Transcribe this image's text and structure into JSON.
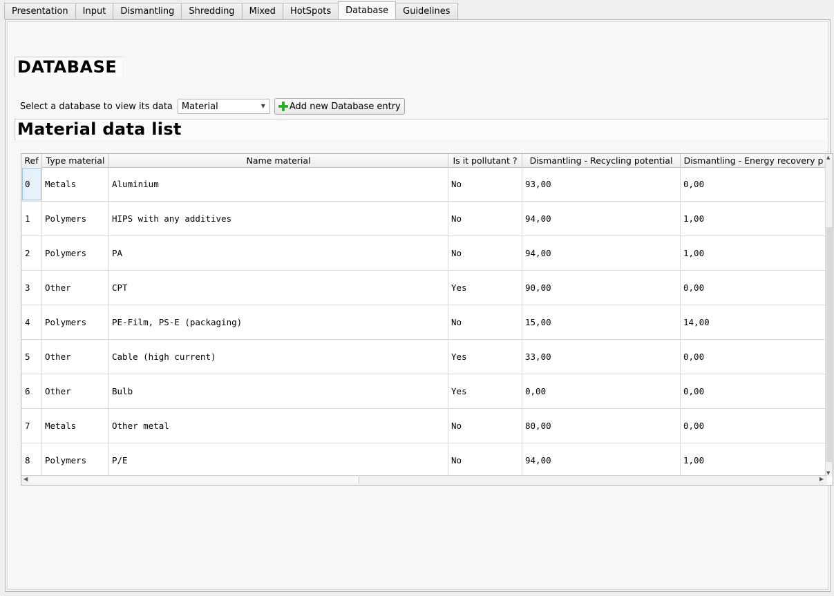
{
  "tabs": [
    "Presentation",
    "Input",
    "Dismantling",
    "Shredding",
    "Mixed",
    "HotSpots",
    "Database",
    "Guidelines"
  ],
  "active_tab": "Database",
  "page_title": "DATABASE",
  "select_label": "Select a database to view its data",
  "select_value": "Material",
  "add_button_label": "Add new Database entry",
  "section_title": "Material data list",
  "table": {
    "headers": [
      "Ref",
      "Type material",
      "Name material",
      "Is it pollutant ?",
      "Dismantling - Recycling potential",
      "Dismantling - Energy recovery p"
    ],
    "rows": [
      [
        "0",
        "Metals",
        "Aluminium",
        "No",
        "93,00",
        "0,00"
      ],
      [
        "1",
        "Polymers",
        "HIPS with any additives",
        "No",
        "94,00",
        "1,00"
      ],
      [
        "2",
        "Polymers",
        "PA",
        "No",
        "94,00",
        "1,00"
      ],
      [
        "3",
        "Other",
        "CPT",
        "Yes",
        "90,00",
        "0,00"
      ],
      [
        "4",
        "Polymers",
        "PE-Film, PS-E (packaging)",
        "No",
        "15,00",
        "14,00"
      ],
      [
        "5",
        "Other",
        "Cable (high current)",
        "Yes",
        "33,00",
        "0,00"
      ],
      [
        "6",
        "Other",
        "Bulb",
        "Yes",
        "0,00",
        "0,00"
      ],
      [
        "7",
        "Metals",
        "Other metal",
        "No",
        "80,00",
        "0,00"
      ],
      [
        "8",
        "Polymers",
        "P/E",
        "No",
        "94,00",
        "1,00"
      ]
    ]
  },
  "icons": {
    "add": "plus-icon",
    "dropdown": "chevron-down-icon"
  }
}
